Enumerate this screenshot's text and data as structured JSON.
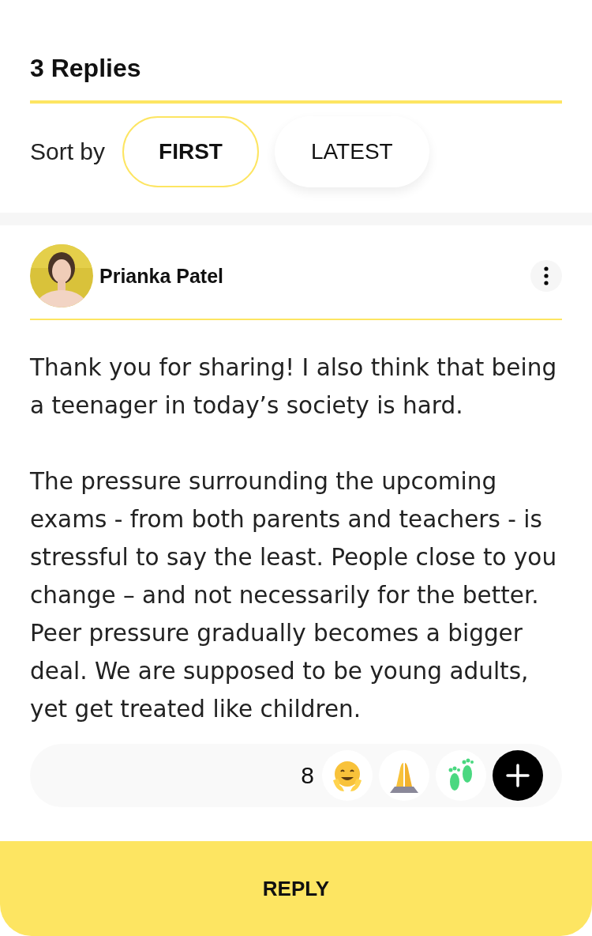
{
  "title": "3 Replies",
  "sort": {
    "label": "Sort by",
    "options": [
      {
        "label": "FIRST",
        "selected": true
      },
      {
        "label": "LATEST",
        "selected": false
      }
    ]
  },
  "comment": {
    "author": "Prianka Patel",
    "paragraphs": [
      "Thank you for sharing! I also think that being a teenager in today’s society is hard.",
      "The pressure surrounding the upcoming exams - from both parents and teachers - is stressful to say the least. People close to you change – and not necessarily for the better. Peer pressure gradually becomes a bigger deal. We are supposed to be young adults, yet get treated like children."
    ],
    "reaction_count": "8",
    "reactions": [
      {
        "kind": "hug"
      },
      {
        "kind": "pray"
      },
      {
        "kind": "feet"
      }
    ]
  },
  "reply_button": "REPLY"
}
